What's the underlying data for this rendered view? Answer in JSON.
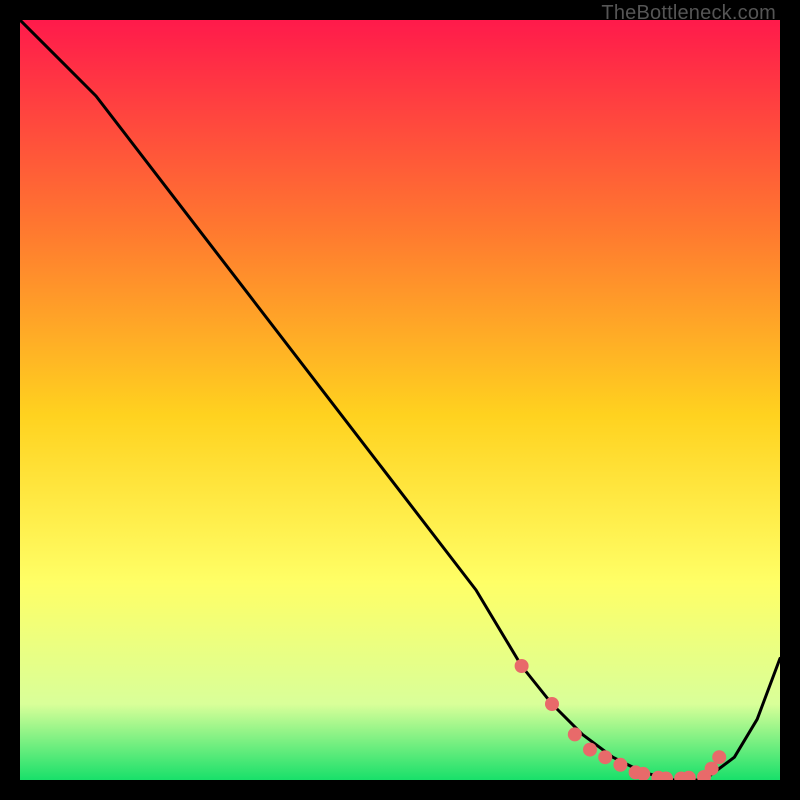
{
  "watermark": "TheBottleneck.com",
  "colors": {
    "gradient_top": "#ff1a4b",
    "gradient_mid_upper": "#ff7a2f",
    "gradient_mid": "#ffd21f",
    "gradient_mid_lower": "#ffff66",
    "gradient_lower": "#d9ff99",
    "gradient_bottom": "#18e06a",
    "curve": "#000000",
    "dot": "#e86a6a",
    "frame_bg": "#000000"
  },
  "chart_data": {
    "type": "line",
    "title": "",
    "xlabel": "",
    "ylabel": "",
    "xlim": [
      0,
      100
    ],
    "ylim": [
      0,
      100
    ],
    "series": [
      {
        "name": "bottleneck-curve",
        "x": [
          0,
          6,
          10,
          20,
          30,
          40,
          50,
          60,
          66,
          70,
          74,
          78,
          82,
          86,
          90,
          94,
          97,
          100
        ],
        "y": [
          100,
          94,
          90,
          77,
          64,
          51,
          38,
          25,
          15,
          10,
          6,
          3,
          1,
          0,
          0,
          3,
          8,
          16
        ]
      }
    ],
    "dots": {
      "name": "highlighted-points",
      "x": [
        66,
        70,
        73,
        75,
        77,
        79,
        81,
        82,
        84,
        85,
        87,
        88,
        90,
        91,
        92
      ],
      "y": [
        15,
        10,
        6,
        4,
        3,
        2,
        1,
        0.8,
        0.3,
        0.2,
        0.2,
        0.3,
        0.4,
        1.5,
        3
      ]
    }
  }
}
